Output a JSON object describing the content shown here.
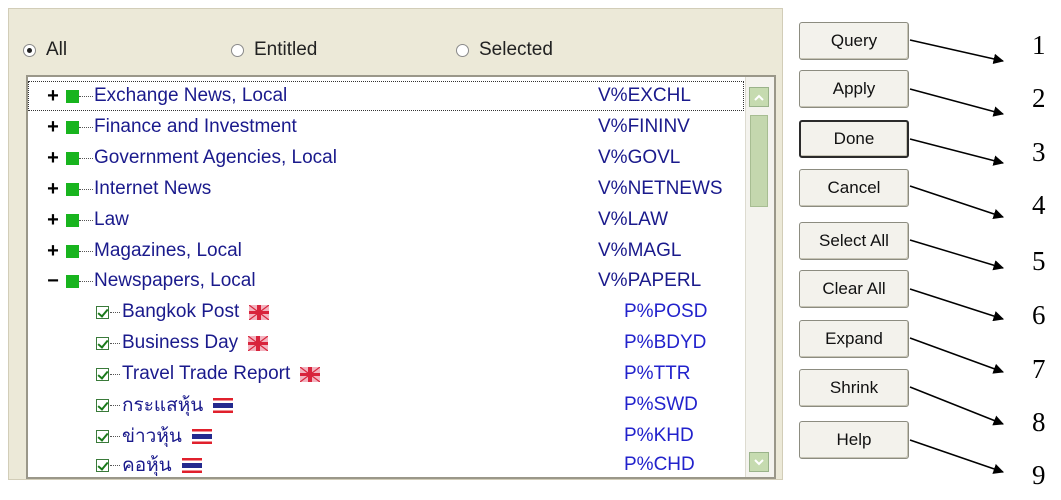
{
  "filter": {
    "options": [
      {
        "label": "All",
        "selected": true
      },
      {
        "label": "Entitled",
        "selected": false
      },
      {
        "label": "Selected",
        "selected": false
      }
    ]
  },
  "categories": [
    {
      "label": "Exchange News, Local",
      "code": "V%EXCHL",
      "expanded": false
    },
    {
      "label": "Finance and Investment",
      "code": "V%FININV",
      "expanded": false
    },
    {
      "label": "Government Agencies, Local",
      "code": "V%GOVL",
      "expanded": false
    },
    {
      "label": "Internet News",
      "code": "V%NETNEWS",
      "expanded": false
    },
    {
      "label": "Law",
      "code": "V%LAW",
      "expanded": false
    },
    {
      "label": "Magazines, Local",
      "code": "V%MAGL",
      "expanded": false
    },
    {
      "label": "Newspapers, Local",
      "code": "V%PAPERL",
      "expanded": true
    }
  ],
  "publications": [
    {
      "label": "Bangkok Post",
      "code": "P%POSD",
      "checked": true,
      "flag": "uk-flag-icon"
    },
    {
      "label": "Business Day",
      "code": "P%BDYD",
      "checked": true,
      "flag": "uk-flag-icon"
    },
    {
      "label": "Travel Trade Report",
      "code": "P%TTR",
      "checked": true,
      "flag": "uk-flag-icon"
    },
    {
      "label": "กระแสหุ้น",
      "code": "P%SWD",
      "checked": true,
      "flag": "thai-flag-icon"
    },
    {
      "label": "ข่าวหุ้น",
      "code": "P%KHD",
      "checked": true,
      "flag": "thai-flag-icon"
    },
    {
      "label": "คอหุ้น",
      "code": "P%CHD",
      "checked": true,
      "flag": "thai-flag-icon"
    }
  ],
  "buttons": [
    {
      "label": "Query",
      "number": "1"
    },
    {
      "label": "Apply",
      "number": "2"
    },
    {
      "label": "Done",
      "number": "3"
    },
    {
      "label": "Cancel",
      "number": "4"
    },
    {
      "label": "Select All",
      "number": "5"
    },
    {
      "label": "Clear All",
      "number": "6"
    },
    {
      "label": "Expand",
      "number": "7"
    },
    {
      "label": "Shrink",
      "number": "8"
    },
    {
      "label": "Help",
      "number": "9"
    }
  ],
  "colors": {
    "panel": "#ece9d8",
    "category_text": "#1a1a8c",
    "code_text": "#2222cc",
    "green_square": "#18b41e",
    "scrollbar": "#c4d7ae"
  }
}
